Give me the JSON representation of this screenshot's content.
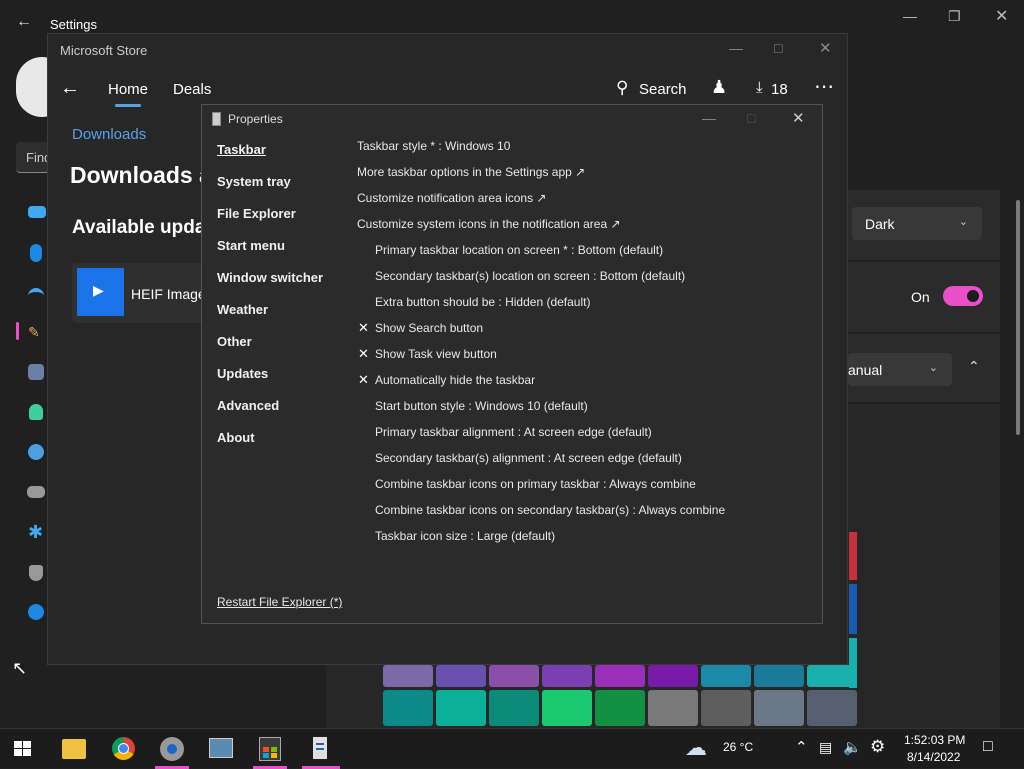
{
  "settings": {
    "title": "Settings",
    "search_placeholder": "Find",
    "dark_label": "Dark",
    "on_label": "On",
    "manual_label": "anual"
  },
  "store": {
    "title": "Microsoft Store",
    "nav_home": "Home",
    "nav_deals": "Deals",
    "search_label": "Search",
    "downloads_count": "18",
    "section_link": "Downloads",
    "heading": "Downloads a",
    "subheading": "Available upda",
    "app_name": "HEIF Image"
  },
  "props": {
    "title": "Properties",
    "nav": [
      "Taskbar",
      "System tray",
      "File Explorer",
      "Start menu",
      "Window switcher",
      "Weather",
      "Other",
      "Updates",
      "Advanced",
      "About"
    ],
    "options": [
      "Taskbar style * : Windows 10",
      "More taskbar options in the Settings app ↗",
      "Customize notification area icons ↗",
      "Customize system icons in the notification area ↗",
      "Primary taskbar location on screen * : Bottom (default)",
      "Secondary taskbar(s) location on screen : Bottom (default)",
      "Extra button should be : Hidden (default)",
      "Show Search button",
      "Show Task view button",
      "Automatically hide the taskbar",
      "Start button style : Windows 10 (default)",
      "Primary taskbar alignment : At screen edge (default)",
      "Secondary taskbar(s) alignment : At screen edge (default)",
      "Combine taskbar icons on primary taskbar : Always combine",
      "Combine taskbar icons on secondary taskbar(s) : Always combine",
      "Taskbar icon size : Large (default)"
    ],
    "check_mark": "✕",
    "restart_link": "Restart File Explorer (*)"
  },
  "taskbar": {
    "temperature": "26 °C",
    "time": "1:52:03 PM",
    "date": "8/14/2022"
  },
  "colors": {
    "accent_pink": "#e84fc8",
    "store_link_blue": "#5aa0e6"
  }
}
